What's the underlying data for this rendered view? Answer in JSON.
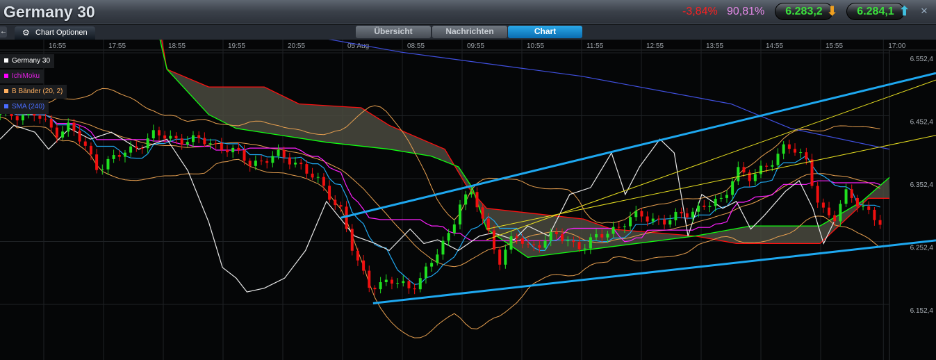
{
  "header": {
    "title": "Germany 30",
    "change_pct": "-3,84%",
    "sentiment_pct": "90,81%",
    "sell_price": "6.283,2",
    "buy_price": "6.284,1",
    "close_label": "×",
    "sell_arrow": "down-arrow-icon",
    "buy_arrow": "up-arrow-icon"
  },
  "toolbar": {
    "back_label": "←",
    "chart_options_label": "Chart Optionen"
  },
  "tabs": [
    {
      "label": "Übersicht",
      "active": false
    },
    {
      "label": "Nachrichten",
      "active": false
    },
    {
      "label": "Chart",
      "active": true
    }
  ],
  "legend": [
    {
      "label": "Germany 30",
      "color": "#ffffff"
    },
    {
      "label": "IchiMoku",
      "color": "#ff00ff"
    },
    {
      "label": "B Bänder (20, 2)",
      "color": "#ffb060"
    },
    {
      "label": "SMA (240)",
      "color": "#4060ff"
    }
  ],
  "chart_data": {
    "type": "line",
    "title": "Germany 30",
    "x_unit": "hours since 16:55 (session-compressed)",
    "xlim": [
      -0.73,
      14.15
    ],
    "ylim": [
      6110,
      6610
    ],
    "grid": true,
    "legend_position": "top-left",
    "x_ticks": [
      {
        "x": 0,
        "label": "16:55"
      },
      {
        "x": 1,
        "label": "17:55"
      },
      {
        "x": 2,
        "label": "18:55"
      },
      {
        "x": 3,
        "label": "19:55"
      },
      {
        "x": 4,
        "label": "20:55"
      },
      {
        "x": 5,
        "label": "05 Aug"
      },
      {
        "x": 6,
        "label": "08:55"
      },
      {
        "x": 7,
        "label": "09:55"
      },
      {
        "x": 8,
        "label": "10:55"
      },
      {
        "x": 9,
        "label": "11:55"
      },
      {
        "x": 10,
        "label": "12:55"
      },
      {
        "x": 11,
        "label": "13:55"
      },
      {
        "x": 12,
        "label": "14:55"
      },
      {
        "x": 13,
        "label": "15:55"
      },
      {
        "x": 14.05,
        "label": "17:00"
      }
    ],
    "y_ticks": [
      {
        "y": 6552.4,
        "label": "6.552,4"
      },
      {
        "y": 6452.4,
        "label": "6.452,4"
      },
      {
        "y": 6352.4,
        "label": "6.352,4"
      },
      {
        "y": 6252.4,
        "label": "6.252,4"
      },
      {
        "y": 6152.4,
        "label": "6.152,4"
      }
    ],
    "candles_close": [
      [
        -0.15,
        6463
      ],
      [
        0.2,
        6435
      ],
      [
        0.43,
        6446
      ],
      [
        0.9,
        6380
      ],
      [
        1.36,
        6402
      ],
      [
        1.83,
        6430
      ],
      [
        2.29,
        6424
      ],
      [
        2.76,
        6419
      ],
      [
        3.1,
        6408
      ],
      [
        3.45,
        6386
      ],
      [
        3.92,
        6397
      ],
      [
        4.27,
        6386
      ],
      [
        4.62,
        6352
      ],
      [
        4.97,
        6314
      ],
      [
        5.2,
        6236
      ],
      [
        5.43,
        6192
      ],
      [
        5.78,
        6198
      ],
      [
        6.13,
        6187
      ],
      [
        6.48,
        6225
      ],
      [
        6.83,
        6281
      ],
      [
        6.94,
        6325
      ],
      [
        7.17,
        6336
      ],
      [
        7.41,
        6281
      ],
      [
        7.64,
        6231
      ],
      [
        7.87,
        6270
      ],
      [
        8.1,
        6253
      ],
      [
        8.57,
        6270
      ],
      [
        9.03,
        6253
      ],
      [
        9.5,
        6281
      ],
      [
        9.97,
        6303
      ],
      [
        10.43,
        6292
      ],
      [
        10.9,
        6314
      ],
      [
        11.36,
        6325
      ],
      [
        11.59,
        6380
      ],
      [
        11.83,
        6358
      ],
      [
        12.06,
        6380
      ],
      [
        12.41,
        6413
      ],
      [
        12.76,
        6391
      ],
      [
        12.99,
        6314
      ],
      [
        13.22,
        6292
      ],
      [
        13.45,
        6347
      ],
      [
        13.69,
        6314
      ],
      [
        14.03,
        6286
      ]
    ],
    "white_line": [
      [
        -0.73,
        6424
      ],
      [
        -0.5,
        6446
      ],
      [
        -0.15,
        6435
      ],
      [
        0.08,
        6408
      ],
      [
        0.43,
        6441
      ],
      [
        0.78,
        6424
      ],
      [
        1.13,
        6435
      ],
      [
        1.59,
        6408
      ],
      [
        2.06,
        6424
      ],
      [
        2.41,
        6374
      ],
      [
        2.76,
        6292
      ],
      [
        2.99,
        6220
      ],
      [
        3.22,
        6203
      ],
      [
        3.4,
        6181
      ],
      [
        3.69,
        6187
      ],
      [
        4.03,
        6203
      ],
      [
        4.38,
        6247
      ],
      [
        4.73,
        6325
      ],
      [
        4.97,
        6297
      ],
      [
        5.2,
        6270
      ],
      [
        5.55,
        6258
      ],
      [
        5.78,
        6247
      ],
      [
        6.13,
        6281
      ],
      [
        6.36,
        6258
      ],
      [
        6.59,
        6264
      ],
      [
        6.94,
        6247
      ],
      [
        7.29,
        6270
      ],
      [
        7.52,
        6275
      ],
      [
        7.87,
        6264
      ],
      [
        8.1,
        6286
      ],
      [
        8.45,
        6270
      ],
      [
        8.8,
        6336
      ],
      [
        9.15,
        6347
      ],
      [
        9.5,
        6402
      ],
      [
        9.73,
        6336
      ],
      [
        9.97,
        6380
      ],
      [
        10.31,
        6424
      ],
      [
        10.55,
        6402
      ],
      [
        10.78,
        6270
      ],
      [
        11.01,
        6336
      ],
      [
        11.36,
        6314
      ],
      [
        11.59,
        6325
      ],
      [
        11.83,
        6281
      ],
      [
        12.06,
        6303
      ],
      [
        12.41,
        6341
      ],
      [
        12.64,
        6358
      ],
      [
        12.87,
        6314
      ],
      [
        13.05,
        6258
      ],
      [
        13.22,
        6292
      ]
    ],
    "sma_240": [
      [
        3.69,
        6601
      ],
      [
        6,
        6562
      ],
      [
        9,
        6524
      ],
      [
        11.5,
        6480
      ],
      [
        12.5,
        6441
      ],
      [
        14.15,
        6408
      ]
    ],
    "ichimoku_span_b": [
      [
        1.94,
        6601
      ],
      [
        2.06,
        6535
      ],
      [
        2.76,
        6507
      ],
      [
        3.69,
        6507
      ],
      [
        4.27,
        6480
      ],
      [
        5.31,
        6474
      ],
      [
        5.78,
        6446
      ],
      [
        6.71,
        6408
      ],
      [
        7.06,
        6352
      ],
      [
        7.41,
        6314
      ],
      [
        9.03,
        6297
      ],
      [
        9.5,
        6281
      ],
      [
        10.9,
        6270
      ],
      [
        11.59,
        6258
      ],
      [
        12.99,
        6258
      ],
      [
        13.8,
        6330
      ],
      [
        14.15,
        6330
      ]
    ],
    "ichimoku_span_a": [
      [
        1.94,
        6584
      ],
      [
        2.06,
        6535
      ],
      [
        2.76,
        6463
      ],
      [
        3.22,
        6441
      ],
      [
        4.73,
        6419
      ],
      [
        5.78,
        6408
      ],
      [
        6.48,
        6397
      ],
      [
        6.94,
        6380
      ],
      [
        7.17,
        6347
      ],
      [
        7.41,
        6281
      ],
      [
        8.1,
        6236
      ],
      [
        10.9,
        6270
      ],
      [
        11.83,
        6286
      ],
      [
        12.99,
        6286
      ],
      [
        13.69,
        6325
      ],
      [
        14.15,
        6363
      ]
    ],
    "trendlines": [
      {
        "color": "#1ea8f0",
        "from": [
          4.97,
          6299
        ],
        "to": [
          14.93,
          6529
        ]
      },
      {
        "color": "#1ea8f0",
        "from": [
          5.51,
          6163
        ],
        "to": [
          14.93,
          6263
        ]
      },
      {
        "color": "#e8e020",
        "from": [
          7.41,
          6264
        ],
        "to": [
          14.93,
          6518
        ]
      },
      {
        "color": "#e8e020",
        "from": [
          7.41,
          6281
        ],
        "to": [
          14.93,
          6430
        ]
      }
    ]
  }
}
